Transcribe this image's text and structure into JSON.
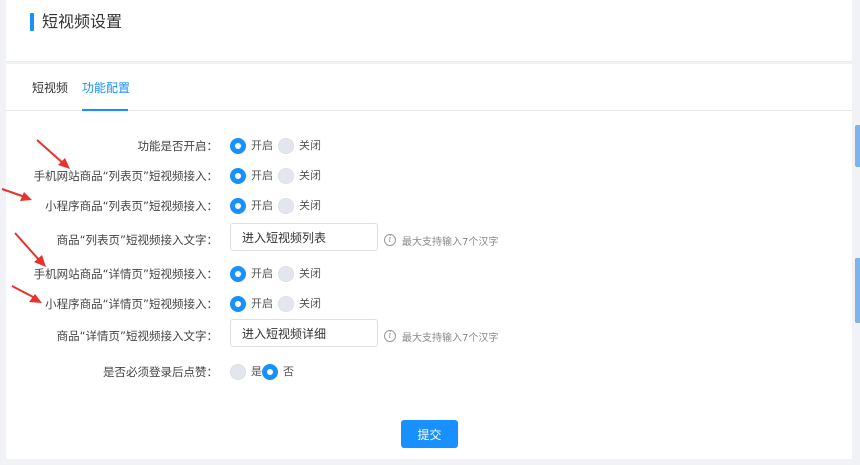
{
  "header": {
    "title": "短视频设置"
  },
  "tabs": [
    {
      "label": "短视频",
      "active": false
    },
    {
      "label": "功能配置",
      "active": true
    }
  ],
  "options": {
    "open": "开启",
    "close": "关闭",
    "yes": "是",
    "no": "否"
  },
  "form": {
    "feature_enabled": {
      "label": "功能是否开启：",
      "selected": "open"
    },
    "mobile_list": {
      "label": "手机网站商品“列表页”短视频接入：",
      "selected": "open"
    },
    "mini_list": {
      "label": "小程序商品“列表页”短视频接入：",
      "selected": "open"
    },
    "list_text": {
      "label": "商品“列表页”短视频接入文字：",
      "value": "进入短视频列表",
      "hint": "最大支持输入7个汉字"
    },
    "mobile_detail": {
      "label": "手机网站商品“详情页”短视频接入：",
      "selected": "open"
    },
    "mini_detail": {
      "label": "小程序商品“详情页”短视频接入：",
      "selected": "open"
    },
    "detail_text": {
      "label": "商品“详情页”短视频接入文字：",
      "value": "进入短视频详细",
      "hint": "最大支持输入7个汉字"
    },
    "login_required": {
      "label": "是否必须登录后点赞：",
      "selected": "no"
    }
  },
  "submit_label": "提交",
  "colors": {
    "accent": "#1890ff",
    "arrow": "#e8322c"
  }
}
